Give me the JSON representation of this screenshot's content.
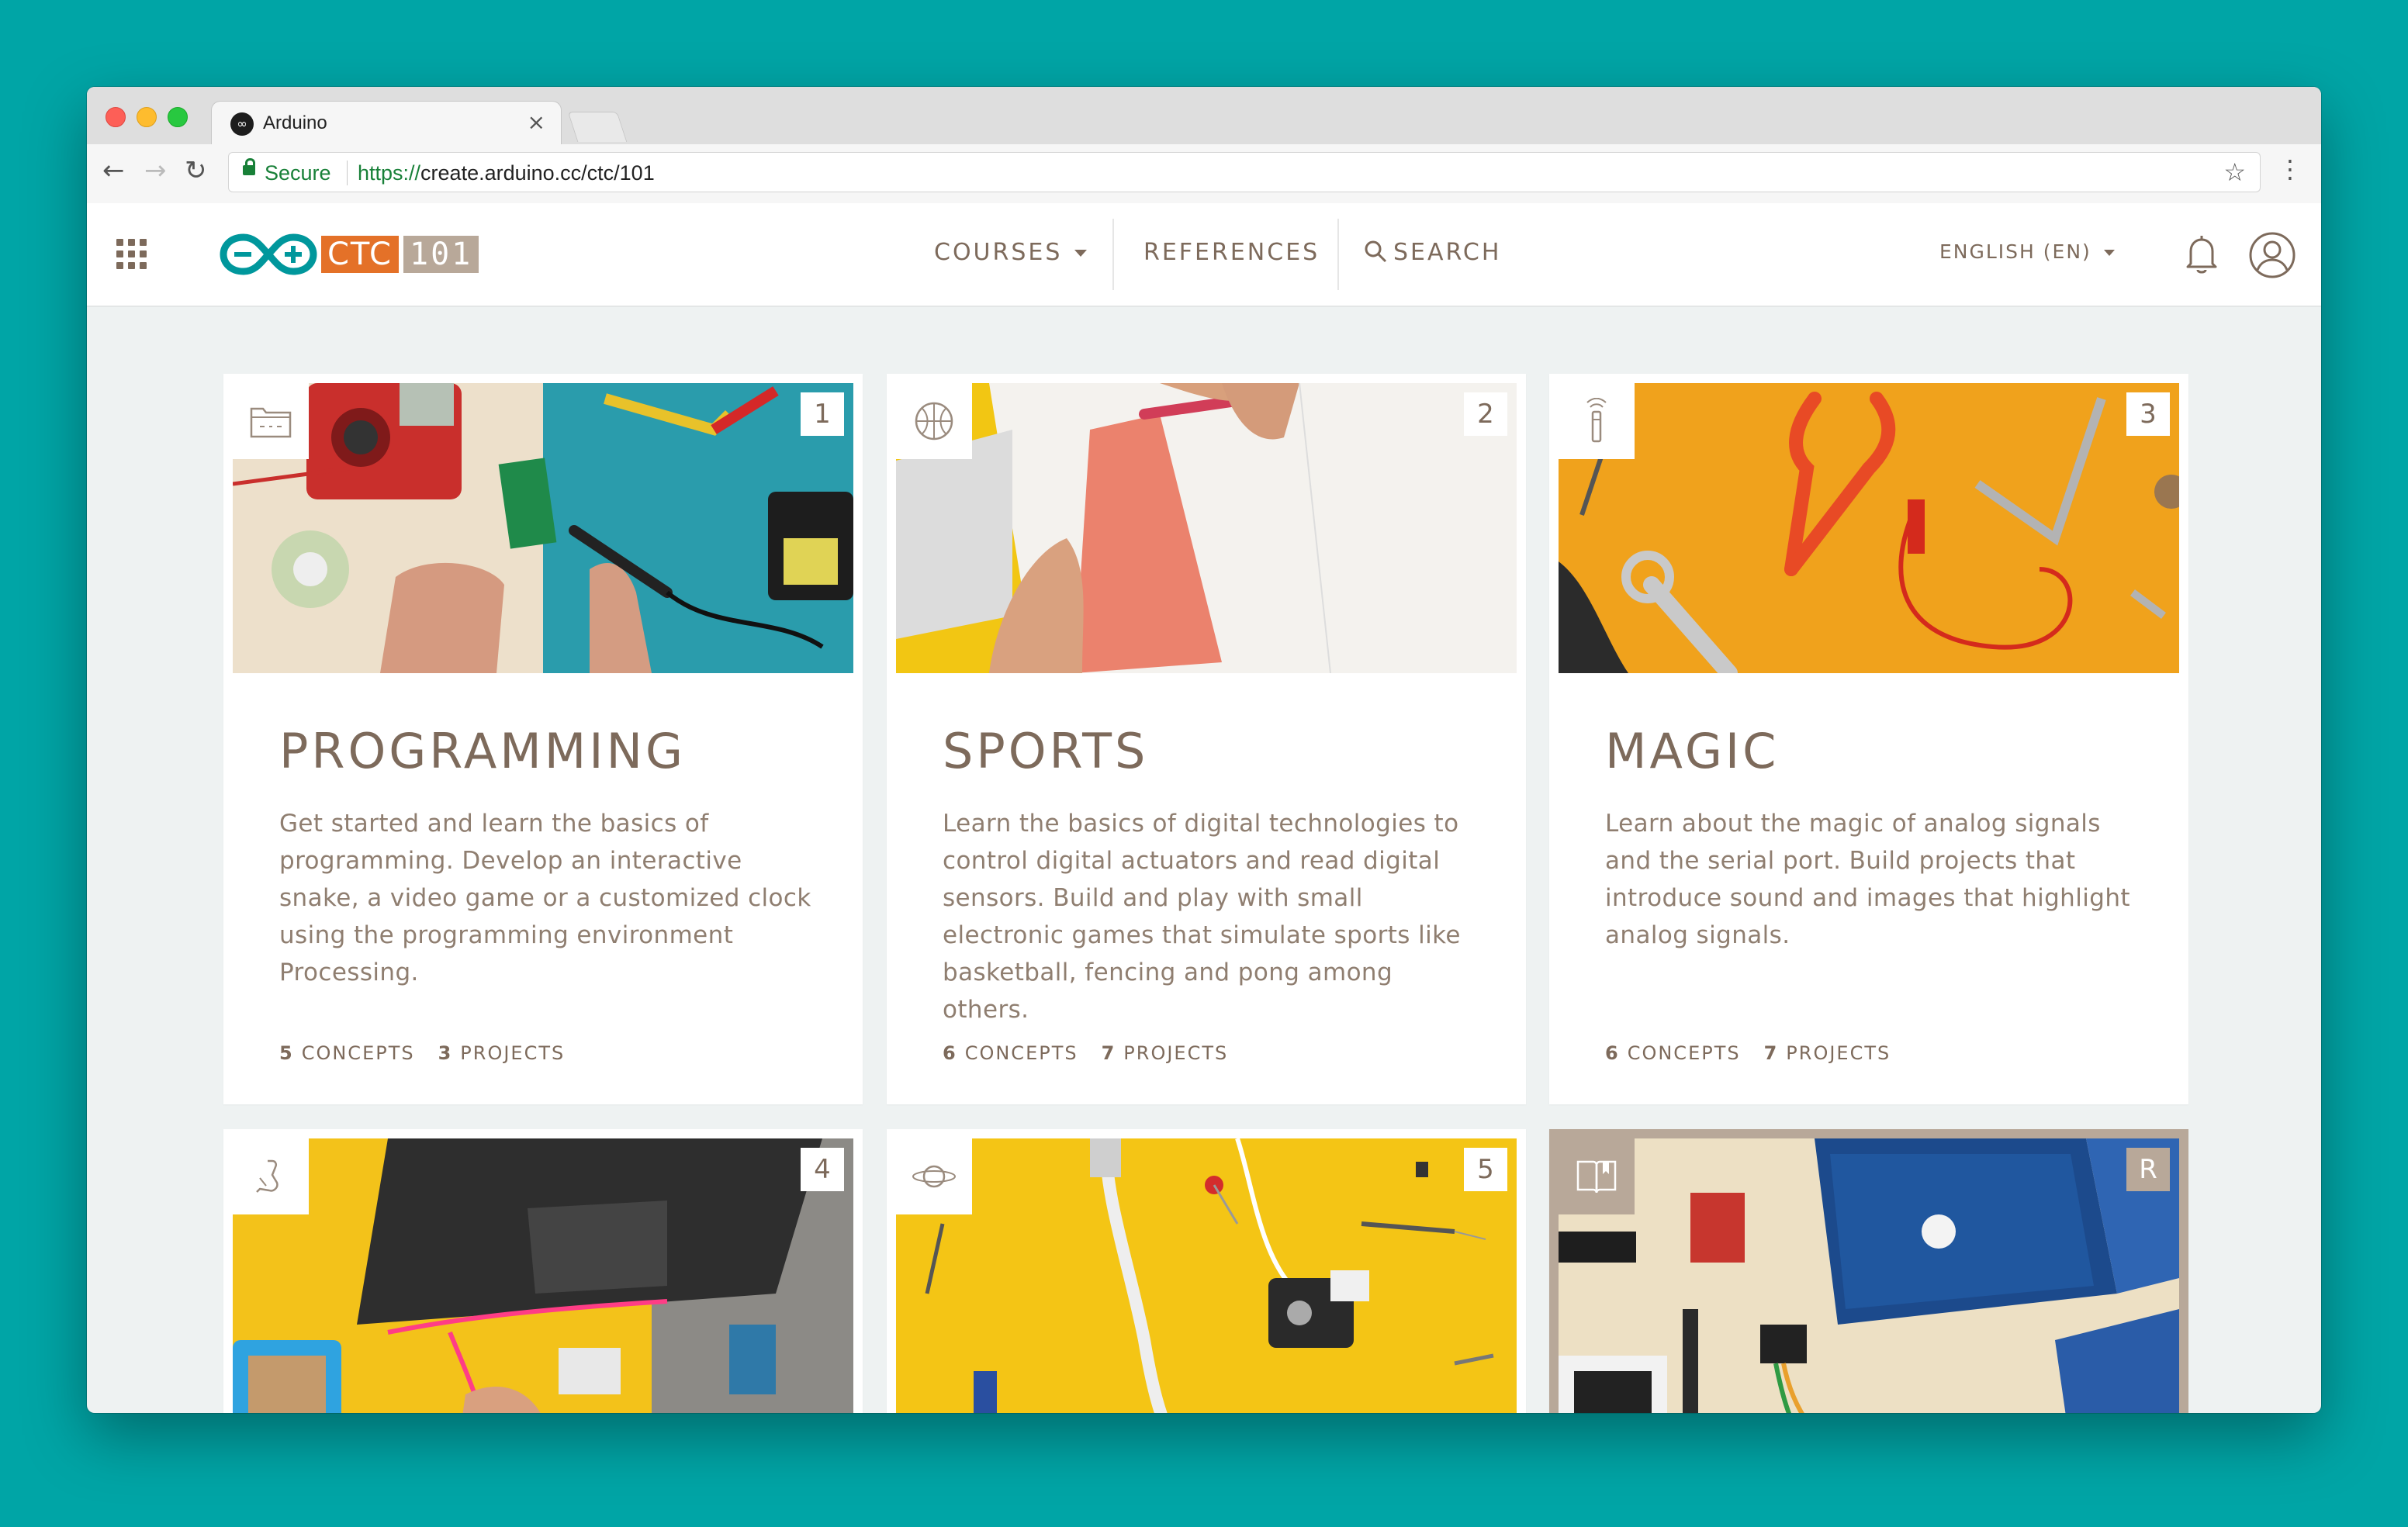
{
  "browser": {
    "tab_title": "Arduino",
    "tab_close": "×",
    "secure_label": "Secure",
    "url_scheme": "https://",
    "url_rest": "create.arduino.cc/ctc/101",
    "back_icon": "←",
    "forward_icon": "→",
    "reload_icon": "↻",
    "star_icon": "☆",
    "menu_icon": "⋮"
  },
  "header": {
    "logo_ctc": "CTC",
    "logo_101": "101",
    "nav": {
      "courses": "COURSES",
      "references": "REFERENCES",
      "search": "SEARCH"
    },
    "language": "ENGLISH (EN)",
    "search_icon": "⌕"
  },
  "cards": [
    {
      "number": "1",
      "icon": "folder-icon",
      "title": "PROGRAMMING",
      "description": "Get started and learn the basics of programming. Develop an interactive snake, a video game or a customized clock using the programming environment Processing.",
      "concepts_count": "5",
      "concepts_label": "CONCEPTS",
      "projects_count": "3",
      "projects_label": "PROJECTS"
    },
    {
      "number": "2",
      "icon": "basketball-icon",
      "title": "SPORTS",
      "description": "Learn the basics of digital technologies to control digital actuators and read digital sensors. Build and play with small electronic games that simulate sports like basketball, fencing and pong among others.",
      "concepts_count": "6",
      "concepts_label": "CONCEPTS",
      "projects_count": "7",
      "projects_label": "PROJECTS"
    },
    {
      "number": "3",
      "icon": "magic-wand-icon",
      "title": "MAGIC",
      "description": "Learn about the magic of analog signals and the serial port. Build projects that introduce sound and images that highlight analog signals.",
      "concepts_count": "6",
      "concepts_label": "CONCEPTS",
      "projects_count": "7",
      "projects_label": "PROJECTS"
    },
    {
      "number": "4",
      "icon": "robot-arm-icon"
    },
    {
      "number": "5",
      "icon": "planet-icon"
    },
    {
      "number": "R",
      "icon": "book-icon"
    }
  ],
  "colors": {
    "background": "#00a5a6",
    "brand_text": "#7d6a5b",
    "ctc_orange": "#e47128",
    "logo_teal": "#00979c",
    "tag_101": "#b8a899"
  }
}
